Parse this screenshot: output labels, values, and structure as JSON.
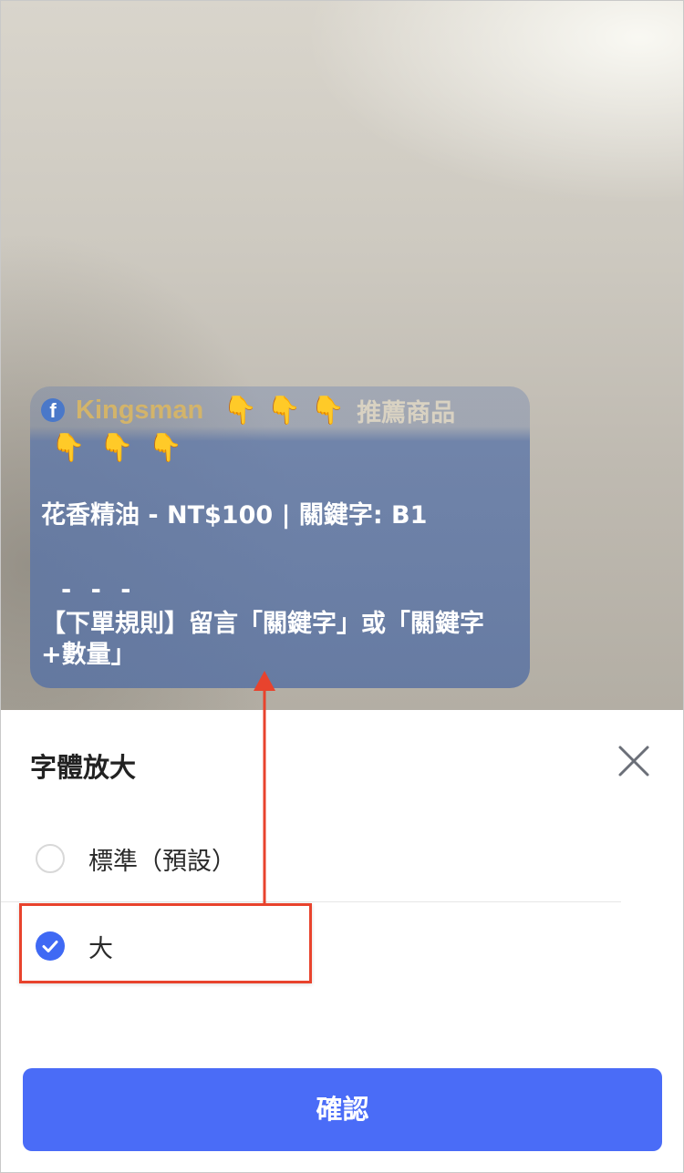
{
  "live_overlay": {
    "author": "Kingsman",
    "pointing_emoji": "👇",
    "tagline": "推薦商品",
    "product_line": "花香精油 - NT$100 | 關鍵字: B1",
    "divider": "- - -",
    "order_rules": "【下單規則】留言「關鍵字」或「關鍵字+數量」",
    "fb_icon": "facebook-icon"
  },
  "sheet": {
    "title": "字體放大",
    "close_icon": "close-icon",
    "options": [
      {
        "label": "標準（預設）",
        "selected": false
      },
      {
        "label": "大",
        "selected": true
      }
    ],
    "confirm_label": "確認"
  },
  "colors": {
    "accent": "#4a6cf7",
    "radio_checked": "#3f69f4",
    "annotation_red": "#e8432d",
    "author_gold": "#d3b46a"
  }
}
